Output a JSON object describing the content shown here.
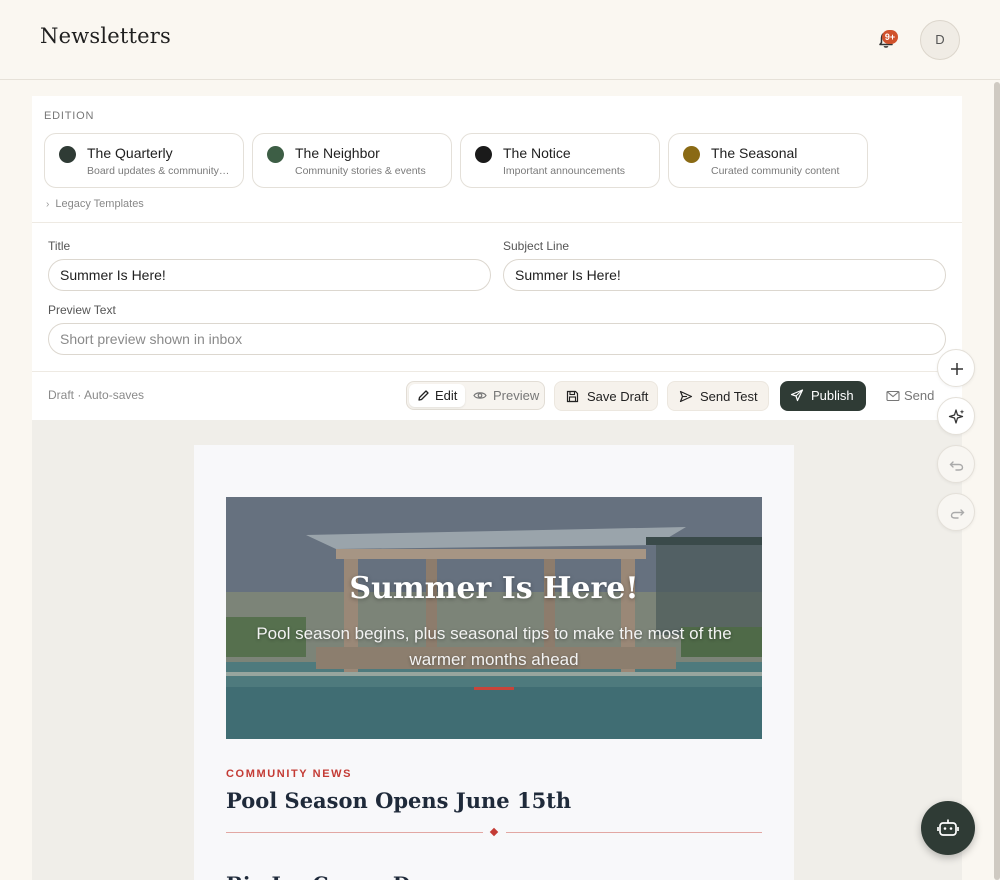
{
  "header": {
    "title": "Newsletters",
    "notification_badge": "9+",
    "avatar_initial": "D"
  },
  "edition": {
    "label": "EDITION",
    "cards": [
      {
        "name": "The Quarterly",
        "desc": "Board updates & community news",
        "color": "#2f3b35"
      },
      {
        "name": "The Neighbor",
        "desc": "Community stories & events",
        "color": "#3d5e45"
      },
      {
        "name": "The Notice",
        "desc": "Important announcements",
        "color": "#1a1a1a"
      },
      {
        "name": "The Seasonal",
        "desc": "Curated community content",
        "color": "#8a6a14"
      }
    ],
    "legacy_label": "Legacy Templates"
  },
  "form": {
    "title_label": "Title",
    "title_value": "Summer Is Here!",
    "subject_label": "Subject Line",
    "subject_value": "Summer Is Here!",
    "preview_label": "Preview Text",
    "preview_placeholder": "Short preview shown in inbox"
  },
  "toolbar": {
    "status": "Draft · Auto-saves",
    "edit_label": "Edit",
    "preview_label": "Preview",
    "save_draft_label": "Save Draft",
    "send_test_label": "Send Test",
    "publish_label": "Publish",
    "send_label": "Send"
  },
  "email": {
    "hero_title": "Summer Is Here!",
    "hero_subtitle": "Pool season begins, plus seasonal tips to make the most of the warmer months ahead",
    "kicker": "COMMUNITY NEWS",
    "article_title": "Pool Season Opens June 15th",
    "next_heading": "Big Ice Cream Day"
  },
  "colors": {
    "accent_dark": "#2f3b35",
    "accent_red": "#c43b35",
    "badge": "#d0522c"
  }
}
